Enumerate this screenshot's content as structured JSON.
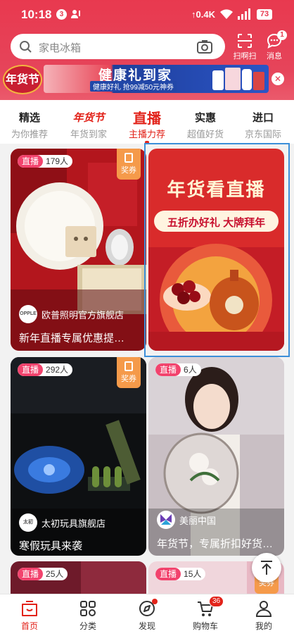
{
  "status_bar": {
    "time": "10:18",
    "notification_count": "3",
    "net_speed": "0.4K",
    "battery": "73"
  },
  "search": {
    "placeholder": "家电冰箱"
  },
  "top_buttons": {
    "scan": "扫啊扫",
    "messages": "消息",
    "message_badge": "1"
  },
  "banner": {
    "logo_text": "年货节",
    "title": "健康礼到家",
    "subtitle": "健康好礼 抢99减50元神券"
  },
  "tabs": [
    {
      "title": "精选",
      "subtitle": "为你推荐"
    },
    {
      "title": "年货节",
      "subtitle": "年货到家"
    },
    {
      "title": "直播",
      "subtitle": "主播力荐"
    },
    {
      "title": "实惠",
      "subtitle": "超值好货"
    },
    {
      "title": "进口",
      "subtitle": "京东国际"
    }
  ],
  "live_label": "直播",
  "coupon_label": "奖券",
  "cards": [
    {
      "viewers": "179人",
      "shop": "欧普照明官方旗舰店",
      "shop_logo": "OPPLE",
      "title": "新年直播专属优惠提…"
    },
    {
      "poster_title": "年货看直播",
      "poster_subtitle": "五折办好礼 大牌拜年"
    },
    {
      "viewers": "292人",
      "shop": "太初玩具旗舰店",
      "shop_logo": "太初",
      "title": "寒假玩具来袭"
    },
    {
      "viewers": "6人",
      "shop": "美丽中国",
      "title": "年货节，专属折扣好货…"
    },
    {
      "viewers": "25人"
    },
    {
      "viewers": "15人"
    }
  ],
  "bottom_nav": [
    {
      "label": "首页"
    },
    {
      "label": "分类"
    },
    {
      "label": "发现"
    },
    {
      "label": "购物车",
      "badge": "36"
    },
    {
      "label": "我的"
    }
  ],
  "colors": {
    "brand_red": "#e8394f",
    "accent_red": "#e2231a",
    "live_pink": "#f2436d",
    "coupon_orange": "#f59a4a",
    "highlight_blue": "#3c8fd9"
  }
}
